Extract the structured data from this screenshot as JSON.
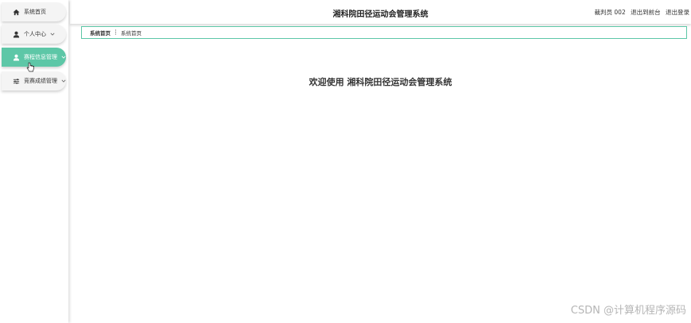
{
  "sidebar": {
    "items": [
      {
        "label": "系统首页",
        "icon": "home-icon"
      },
      {
        "label": "个人中心",
        "icon": "user-icon"
      },
      {
        "label": "赛程信息管理",
        "icon": "user-icon"
      },
      {
        "label": "竞赛成绩管理",
        "icon": "sliders-icon"
      }
    ],
    "active_color": "#5dc7a7"
  },
  "header": {
    "title": "湘科院田径运动会管理系统",
    "user": "裁判员 002",
    "to_front": "退出到前台",
    "logout": "退出登录"
  },
  "breadcrumb": {
    "root": "系统首页",
    "current": "系统首页"
  },
  "main": {
    "welcome": "欢迎使用 湘科院田径运动会管理系统"
  },
  "watermark": "CSDN @计算机程序源码"
}
